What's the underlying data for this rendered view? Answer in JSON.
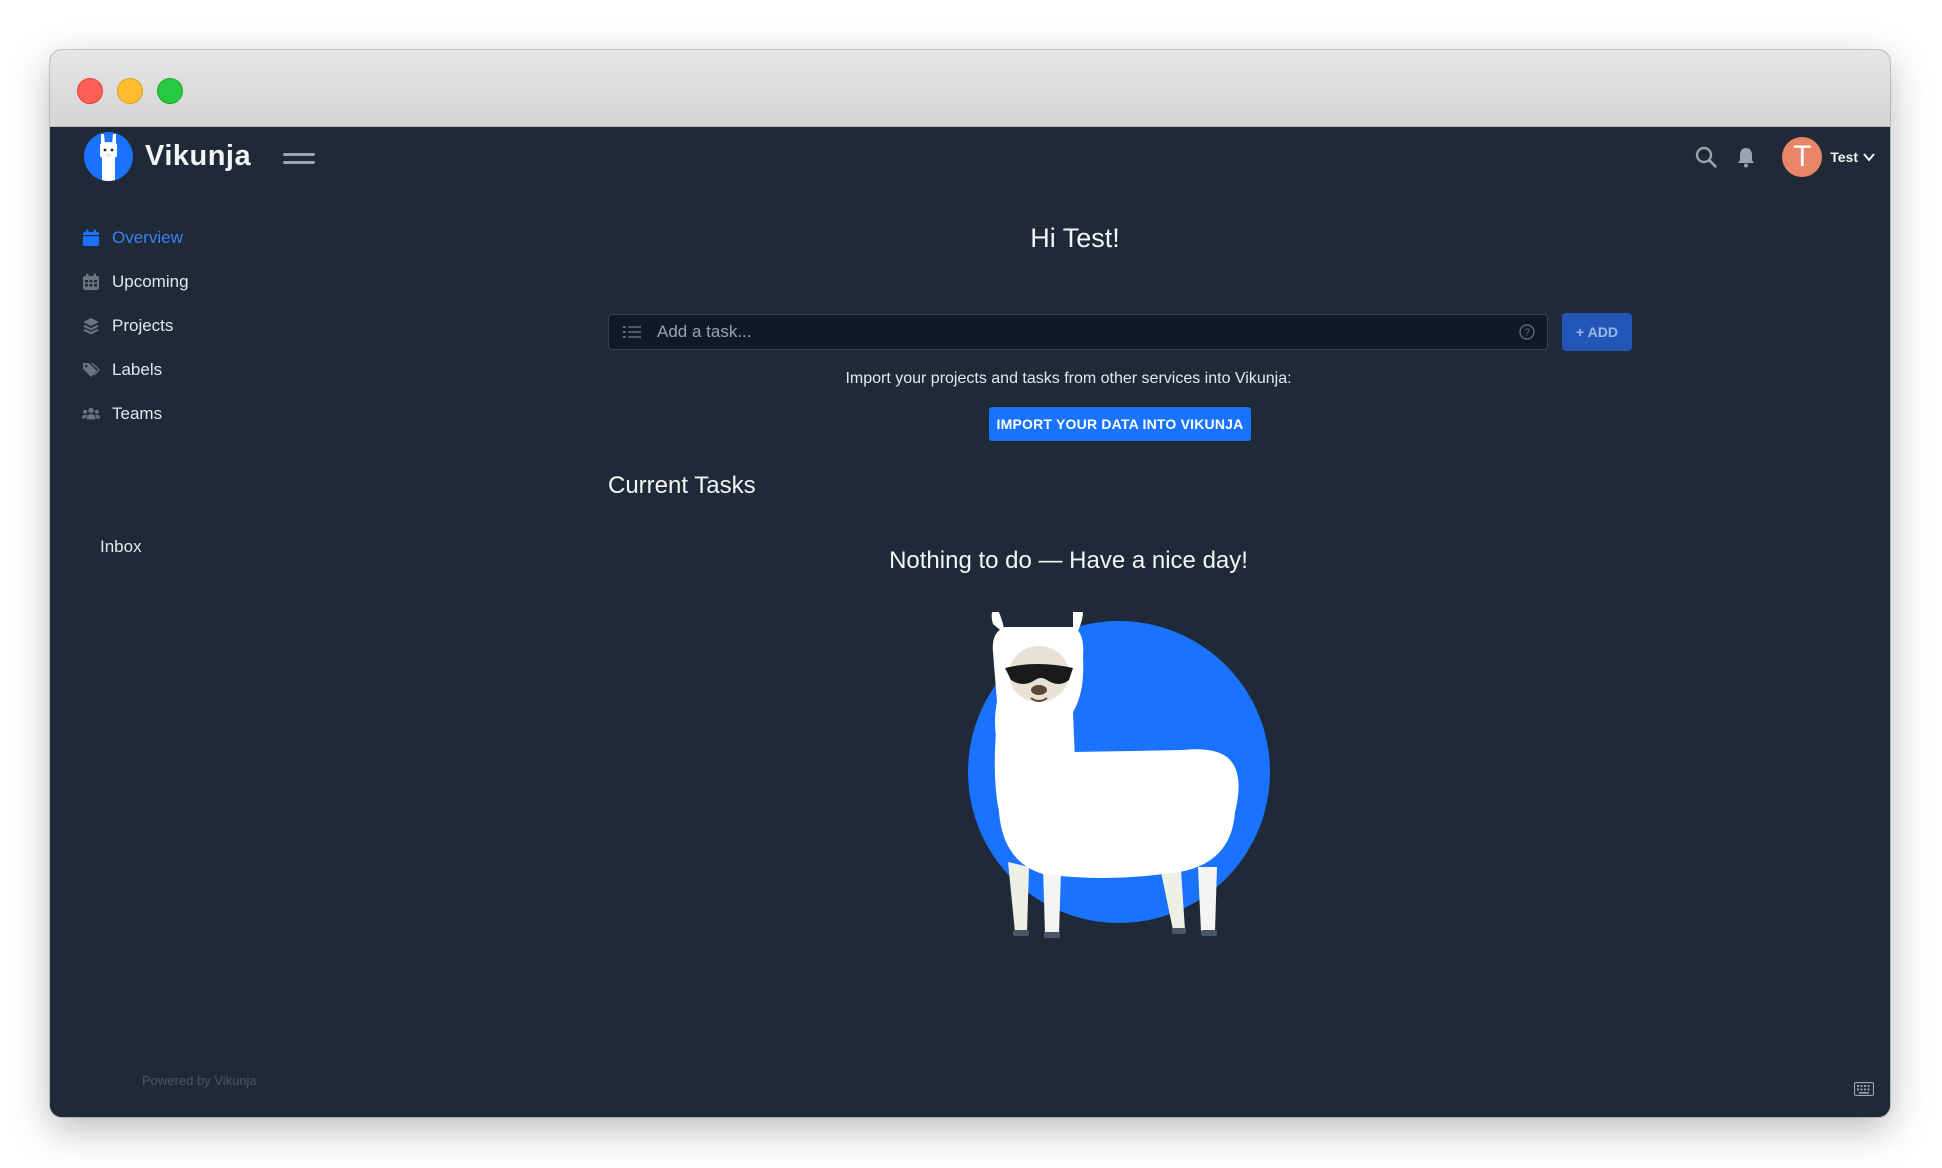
{
  "app": {
    "name": "Vikunja",
    "accent_color": "#1973ff",
    "background_color": "#1f2937"
  },
  "navbar": {
    "search_icon": "search-icon",
    "notifications_icon": "bell-icon",
    "user": {
      "initial": "T",
      "name": "Test",
      "avatar_color": "#e98667"
    }
  },
  "sidebar": {
    "items": [
      {
        "label": "Overview",
        "icon": "calendar-icon",
        "active": true
      },
      {
        "label": "Upcoming",
        "icon": "calendar-grid-icon",
        "active": false
      },
      {
        "label": "Projects",
        "icon": "layers-icon",
        "active": false
      },
      {
        "label": "Labels",
        "icon": "tags-icon",
        "active": false
      },
      {
        "label": "Teams",
        "icon": "users-icon",
        "active": false
      }
    ],
    "projects": [
      {
        "label": "Inbox"
      }
    ],
    "footer": "Powered by Vikunja"
  },
  "main": {
    "greeting": "Hi Test!",
    "add_task": {
      "placeholder": "Add a task...",
      "button_label": "+ ADD"
    },
    "import": {
      "text": "Import your projects and tasks from other services into Vikunja:",
      "button_label": "IMPORT YOUR DATA INTO VIKUNJA"
    },
    "current_tasks_heading": "Current Tasks",
    "empty_message": "Nothing to do — Have a nice day!"
  }
}
